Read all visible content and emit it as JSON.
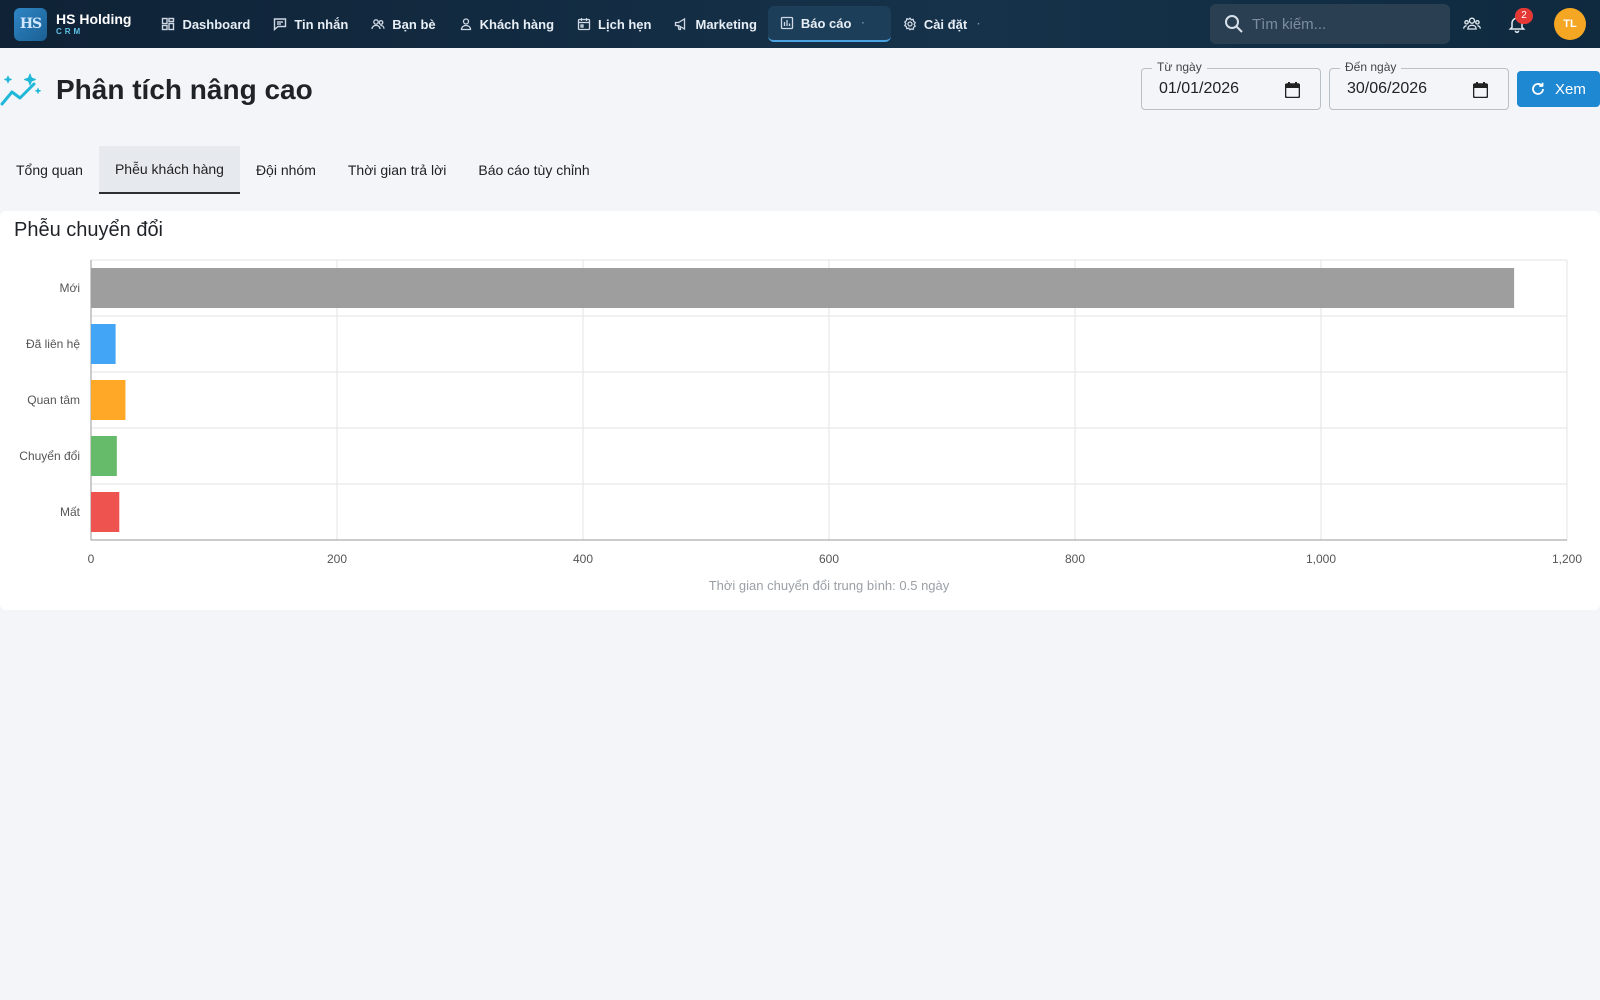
{
  "brand": {
    "logo_text": "HS",
    "name": "HS Holding",
    "sub": "CRM"
  },
  "nav": {
    "items": [
      {
        "label": "Dashboard",
        "icon": "dashboard-icon"
      },
      {
        "label": "Tin nhắn",
        "icon": "message-icon"
      },
      {
        "label": "Bạn bè",
        "icon": "friends-icon"
      },
      {
        "label": "Khách hàng",
        "icon": "customer-icon"
      },
      {
        "label": "Lịch hẹn",
        "icon": "calendar-icon"
      },
      {
        "label": "Marketing",
        "icon": "megaphone-icon"
      },
      {
        "label": "Báo cáo",
        "icon": "report-icon",
        "active": true
      },
      {
        "label": "Cài đặt",
        "icon": "gear-icon"
      }
    ]
  },
  "search": {
    "placeholder": "Tìm kiếm..."
  },
  "notifications": {
    "count": "2"
  },
  "user": {
    "initials": "TL"
  },
  "page": {
    "title": "Phân tích nâng cao"
  },
  "filters": {
    "from_label": "Từ ngày",
    "from_value": "01/01/2026",
    "to_label": "Đến ngày",
    "to_value": "30/06/2026",
    "view_button": "Xem"
  },
  "tabs": [
    {
      "label": "Tổng quan"
    },
    {
      "label": "Phễu khách hàng",
      "active": true
    },
    {
      "label": "Đội nhóm"
    },
    {
      "label": "Thời gian trả lời"
    },
    {
      "label": "Báo cáo tùy chỉnh"
    }
  ],
  "card": {
    "title": "Phễu chuyển đổi"
  },
  "chart_data": {
    "type": "bar",
    "orientation": "horizontal",
    "title": "",
    "categories": [
      "Mới",
      "Đã liên hệ",
      "Quan tâm",
      "Chuyển đổi",
      "Mất"
    ],
    "values": [
      1157,
      20,
      28,
      21,
      23
    ],
    "colors": [
      "#9e9e9e",
      "#42a5f5",
      "#ffa726",
      "#66bb6a",
      "#ef5350"
    ],
    "xlim": [
      0,
      1200
    ],
    "xticks": [
      "0",
      "200",
      "400",
      "600",
      "800",
      "1,000",
      "1,200"
    ],
    "xtick_values": [
      0,
      200,
      400,
      600,
      800,
      1000,
      1200
    ],
    "grid": true,
    "note": "Thời gian chuyển đổi trung bình: 0.5 ngày"
  }
}
